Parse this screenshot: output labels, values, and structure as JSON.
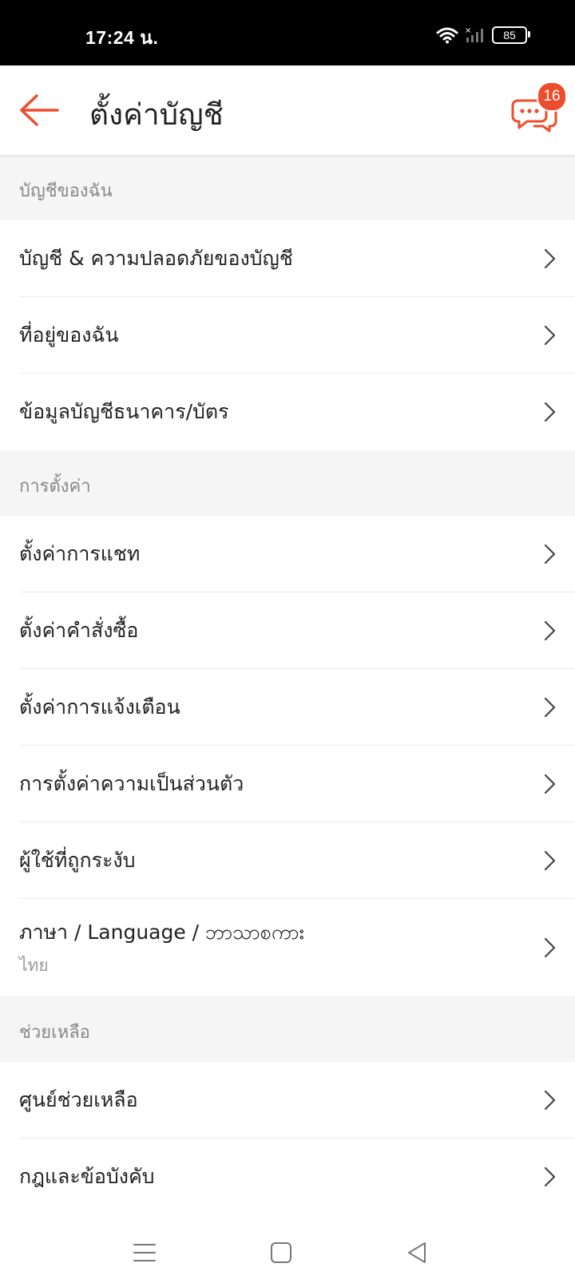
{
  "status_bar": {
    "time": "17:24 น.",
    "battery": "85",
    "icons": [
      "wifi-icon",
      "signal-icon",
      "battery-icon"
    ]
  },
  "header": {
    "title": "ตั้งค่าบัญชี",
    "chat_badge": "16",
    "accent_color": "#ee4d2d"
  },
  "sections": [
    {
      "title": "บัญชีของฉัน",
      "items": [
        {
          "label": "บัญชี & ความปลอดภัยของบัญชี"
        },
        {
          "label": "ที่อยู่ของฉัน"
        },
        {
          "label": "ข้อมูลบัญชีธนาคาร/บัตร"
        }
      ]
    },
    {
      "title": "การตั้งค่า",
      "items": [
        {
          "label": "ตั้งค่าการแชท"
        },
        {
          "label": "ตั้งค่าคำสั่งซื้อ"
        },
        {
          "label": "ตั้งค่าการแจ้งเตือน"
        },
        {
          "label": "การตั้งค่าความเป็นส่วนตัว"
        },
        {
          "label": "ผู้ใช้ที่ถูกระงับ"
        },
        {
          "label": "ภาษา / Language / ဘာသာစကား",
          "sub": "ไทย"
        }
      ]
    },
    {
      "title": "ช่วยเหลือ",
      "items": [
        {
          "label": "ศูนย์ช่วยเหลือ"
        },
        {
          "label": "กฎและข้อบังคับ"
        }
      ]
    }
  ],
  "nav_bar": {
    "icons": [
      "menu-icon",
      "home-square-icon",
      "back-triangle-icon"
    ]
  }
}
